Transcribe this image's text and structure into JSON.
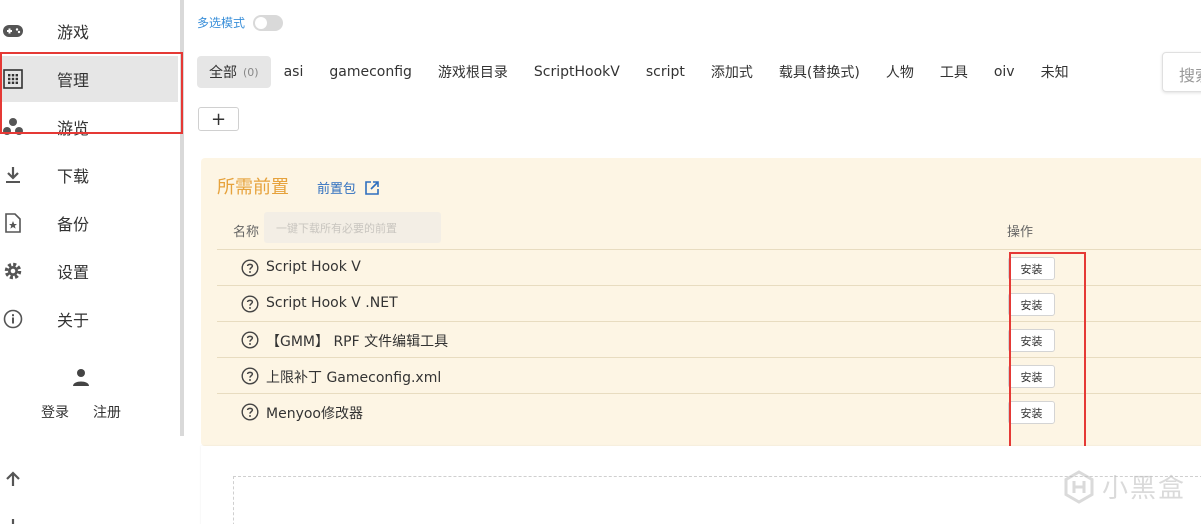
{
  "sidebar": {
    "items": [
      {
        "label": "游戏",
        "icon": "gamepad-icon"
      },
      {
        "label": "管理",
        "icon": "grid-icon",
        "active": true
      },
      {
        "label": "游览",
        "icon": "bubbles-icon"
      },
      {
        "label": "下载",
        "icon": "download-icon"
      },
      {
        "label": "备份",
        "icon": "file-star-icon"
      },
      {
        "label": "设置",
        "icon": "gear-icon"
      },
      {
        "label": "关于",
        "icon": "info-icon"
      }
    ],
    "login_label": "登录",
    "register_label": "注册"
  },
  "main": {
    "multi_select_label": "多选模式",
    "tabs": [
      {
        "label": "全部",
        "count": "(0)",
        "active": true
      },
      {
        "label": "asi"
      },
      {
        "label": "gameconfig"
      },
      {
        "label": "游戏根目录"
      },
      {
        "label": "ScriptHookV"
      },
      {
        "label": "script"
      },
      {
        "label": "添加式"
      },
      {
        "label": "载具(替换式)"
      },
      {
        "label": "人物"
      },
      {
        "label": "工具"
      },
      {
        "label": "oiv"
      },
      {
        "label": "未知"
      }
    ],
    "search_placeholder": "搜索",
    "add_label": "+"
  },
  "panel": {
    "title": "所需前置",
    "link_label": "前置包",
    "col_name": "名称",
    "col_op": "操作",
    "tooltip_ghost": "一键下载所有必要的前置",
    "rows": [
      {
        "name": "Script Hook V",
        "action": "安装"
      },
      {
        "name": "Script Hook V .NET",
        "action": "安装"
      },
      {
        "name": "【GMM】 RPF 文件编辑工具",
        "action": "安装"
      },
      {
        "name": "上限补丁 Gameconfig.xml",
        "action": "安装"
      },
      {
        "name": "Menyoo修改器",
        "action": "安装"
      }
    ]
  },
  "watermark": {
    "text": "小黑盒"
  },
  "colors": {
    "accent_blue": "#3a8fd9",
    "panel_bg": "#fdf5e4",
    "title_orange": "#e6a23c",
    "highlight_red": "#e53935"
  }
}
